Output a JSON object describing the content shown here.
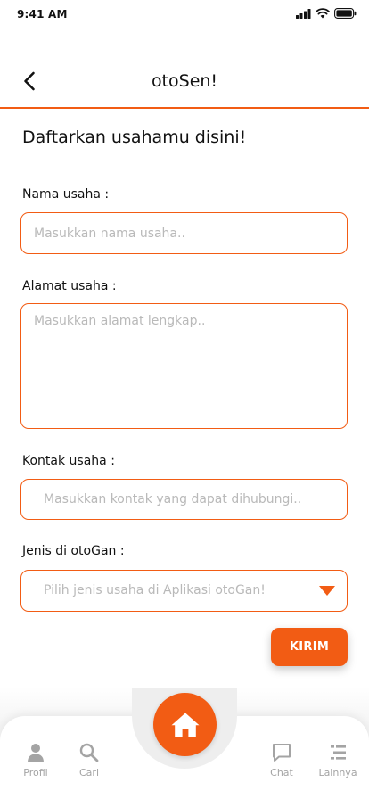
{
  "status_bar": {
    "time": "9:41 AM"
  },
  "header": {
    "title": "otoSen!",
    "back_icon": "chevron-left-icon"
  },
  "form": {
    "heading": "Daftarkan usahamu disini!",
    "fields": {
      "name": {
        "label": "Nama usaha :",
        "placeholder": "Masukkan nama usaha.."
      },
      "address": {
        "label": "Alamat usaha :",
        "placeholder": "Masukkan alamat lengkap.."
      },
      "contact": {
        "label": "Kontak usaha :",
        "placeholder": "Masukkan kontak yang dapat dihubungi.."
      },
      "type": {
        "label": "Jenis di otoGan :",
        "placeholder": "Pilih jenis usaha di Aplikasi otoGan!"
      }
    },
    "submit_label": "KIRIM"
  },
  "bottom_nav": {
    "items": [
      {
        "label": "Profil",
        "icon": "person-icon"
      },
      {
        "label": "Cari",
        "icon": "search-icon"
      },
      {
        "label": "Chat",
        "icon": "chat-icon"
      },
      {
        "label": "Lainnya",
        "icon": "list-icon"
      }
    ],
    "home_icon": "home-icon"
  },
  "colors": {
    "accent": "#f25c14",
    "placeholder": "#b9b9b9",
    "inactive_tab": "#a4a4a4"
  }
}
